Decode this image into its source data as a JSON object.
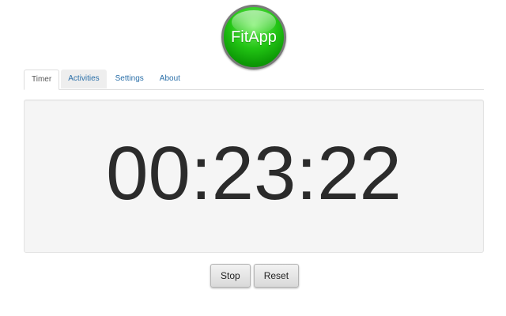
{
  "app": {
    "logo_text": "FitApp"
  },
  "tabs": [
    {
      "label": "Timer",
      "active": true
    },
    {
      "label": "Activities",
      "active": false
    },
    {
      "label": "Settings",
      "active": false
    },
    {
      "label": "About",
      "active": false
    }
  ],
  "timer": {
    "display": "00:23:22"
  },
  "controls": {
    "stop_label": "Stop",
    "reset_label": "Reset"
  },
  "colors": {
    "logo_green": "#22c414",
    "tab_link": "#2a6fa8",
    "panel_bg": "#f5f5f5",
    "timer_text": "#2b2b2b"
  }
}
